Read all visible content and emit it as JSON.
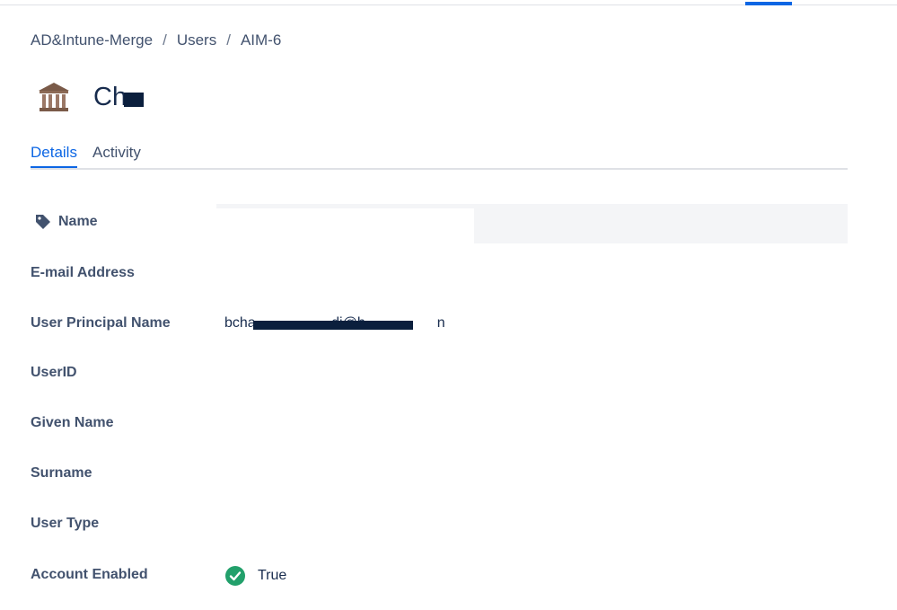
{
  "breadcrumb": [
    {
      "label": "AD&Intune-Merge"
    },
    {
      "label": "Users"
    },
    {
      "label": "AIM-6"
    }
  ],
  "breadcrumb_separator": "/",
  "header": {
    "icon": "bank-building-icon",
    "title": "Ch"
  },
  "tabs": [
    {
      "label": "Details",
      "active": true
    },
    {
      "label": "Activity",
      "active": false
    }
  ],
  "fields": {
    "name": {
      "label": "Name",
      "icon": "tag-icon",
      "value": ""
    },
    "email": {
      "label": "E-mail Address",
      "value": ""
    },
    "upn": {
      "label": "User Principal Name",
      "value": "bcha                   di@h                  n"
    },
    "userid": {
      "label": "UserID",
      "value": ""
    },
    "given_name": {
      "label": "Given Name",
      "value": ""
    },
    "surname": {
      "label": "Surname",
      "value": ""
    },
    "user_type": {
      "label": "User Type",
      "value": ""
    },
    "account_enabled": {
      "label": "Account Enabled",
      "value": "True",
      "icon": "check-circle-icon"
    }
  },
  "colors": {
    "accent": "#0c66e4",
    "text": "#172b4d",
    "label": "#42526e",
    "success": "#22a06b",
    "redaction": "#0b1f3d"
  }
}
